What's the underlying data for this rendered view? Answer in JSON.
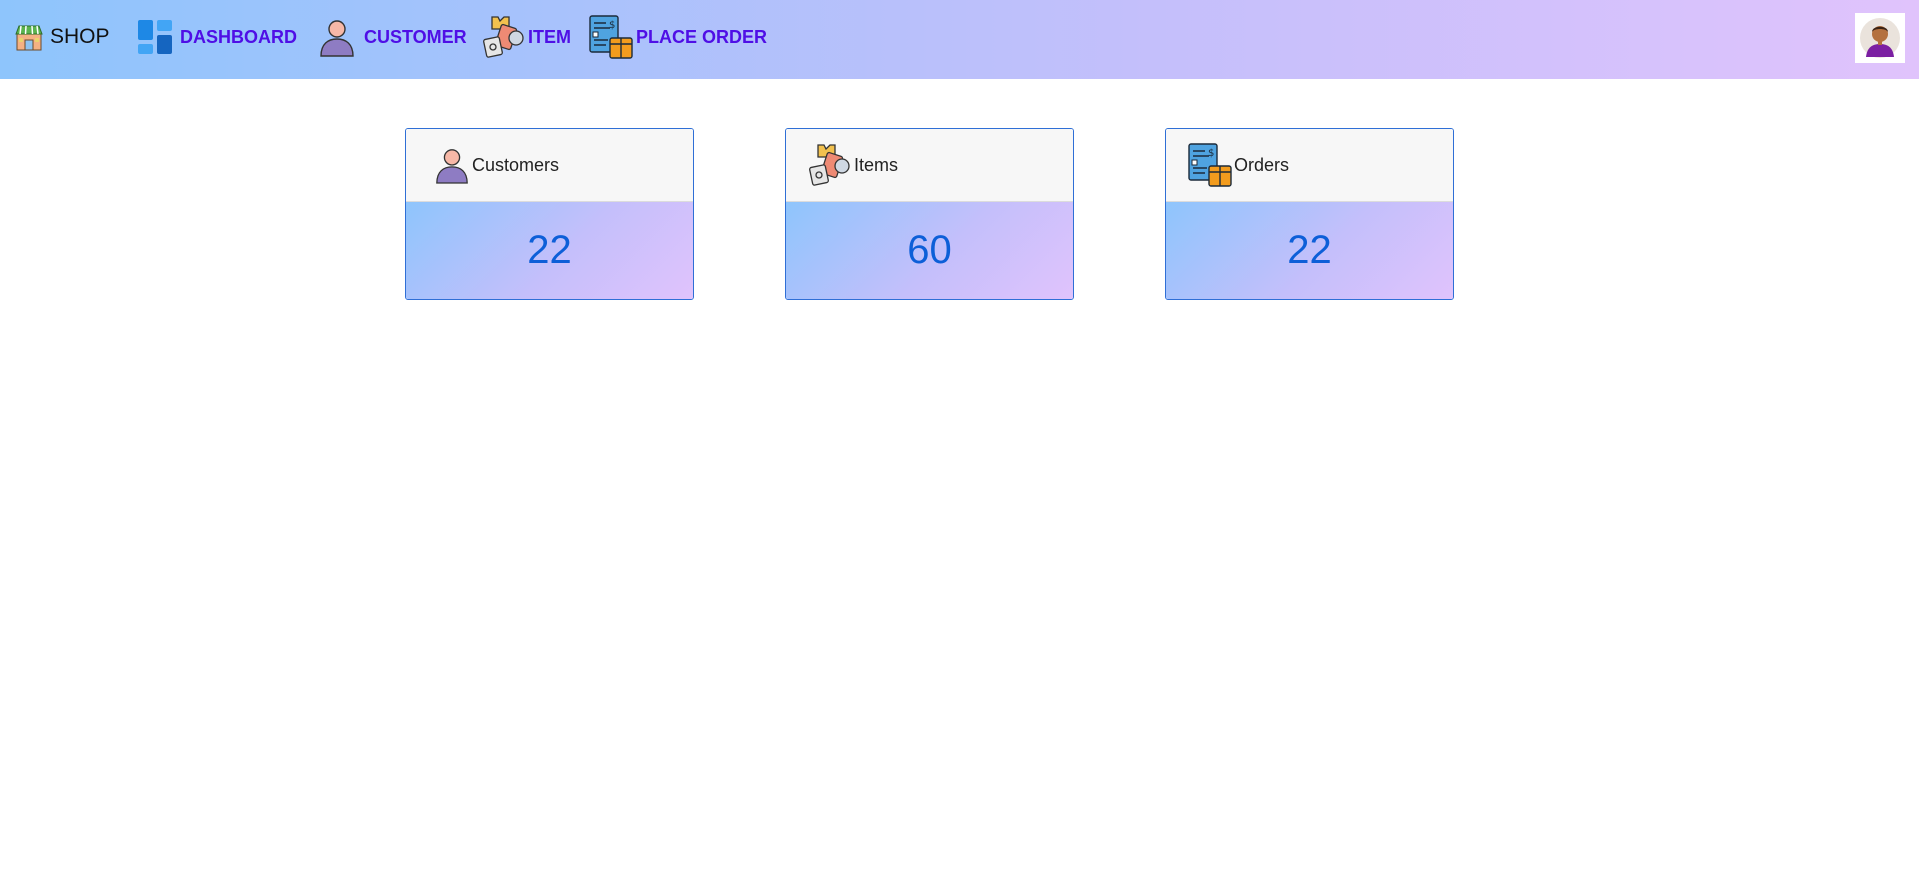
{
  "navbar": {
    "brand": {
      "label": "SHOP",
      "icon": "shop-icon"
    },
    "items": [
      {
        "label": "DASHBOARD",
        "icon": "dashboard-icon"
      },
      {
        "label": "CUSTOMER",
        "icon": "customer-icon"
      },
      {
        "label": "ITEM",
        "icon": "item-icon"
      },
      {
        "label": "PLACE ORDER",
        "icon": "place-order-icon"
      }
    ],
    "avatar_icon": "user-avatar-icon"
  },
  "cards": [
    {
      "title": "Customers",
      "count": "22",
      "icon": "customer-icon"
    },
    {
      "title": "Items",
      "count": "60",
      "icon": "item-icon"
    },
    {
      "title": "Orders",
      "count": "22",
      "icon": "order-icon"
    }
  ],
  "colors": {
    "nav_gradient_start": "#8ec5fc",
    "nav_gradient_end": "#e0c3fc",
    "nav_link": "#4f0fe6",
    "card_border": "#2f6fd6",
    "count_text": "#0d5fd8"
  }
}
